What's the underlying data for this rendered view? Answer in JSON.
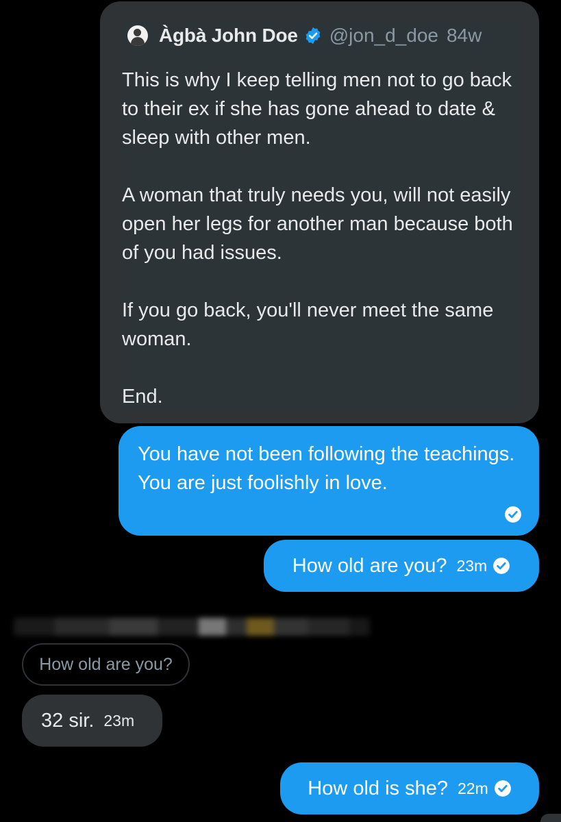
{
  "conversation": {
    "quoted_tweet": {
      "author_name": "Àgbà John Doe",
      "handle": "@jon_d_doe",
      "time": "84w",
      "text": "This is why I keep telling men not to go back to their ex if she has gone ahead to date & sleep with other men.\n\nA woman that truly needs you, will not easily open her legs for another man because both of you had issues.\n\nIf you go back, you'll never meet the same woman.\n\nEnd."
    },
    "messages": [
      {
        "text": "You have not been following the teachings. You are just foolishly in love.",
        "direction": "sent",
        "status_icon": "check-circle-icon"
      },
      {
        "text": "How old are you?",
        "time": "23m",
        "direction": "sent",
        "status_icon": "check-circle-icon"
      },
      {
        "reply_context": "How old are you?",
        "text": "32 sir.",
        "time": "23m",
        "direction": "received"
      },
      {
        "text": "How old is she?",
        "time": "22m",
        "direction": "sent",
        "status_icon": "check-circle-icon"
      }
    ]
  },
  "colors": {
    "background": "#000000",
    "sent_bubble": "#1d9bf0",
    "received_bubble": "#2f3336",
    "verified_badge": "#1d9bf0",
    "muted_text": "#8b98a5"
  }
}
